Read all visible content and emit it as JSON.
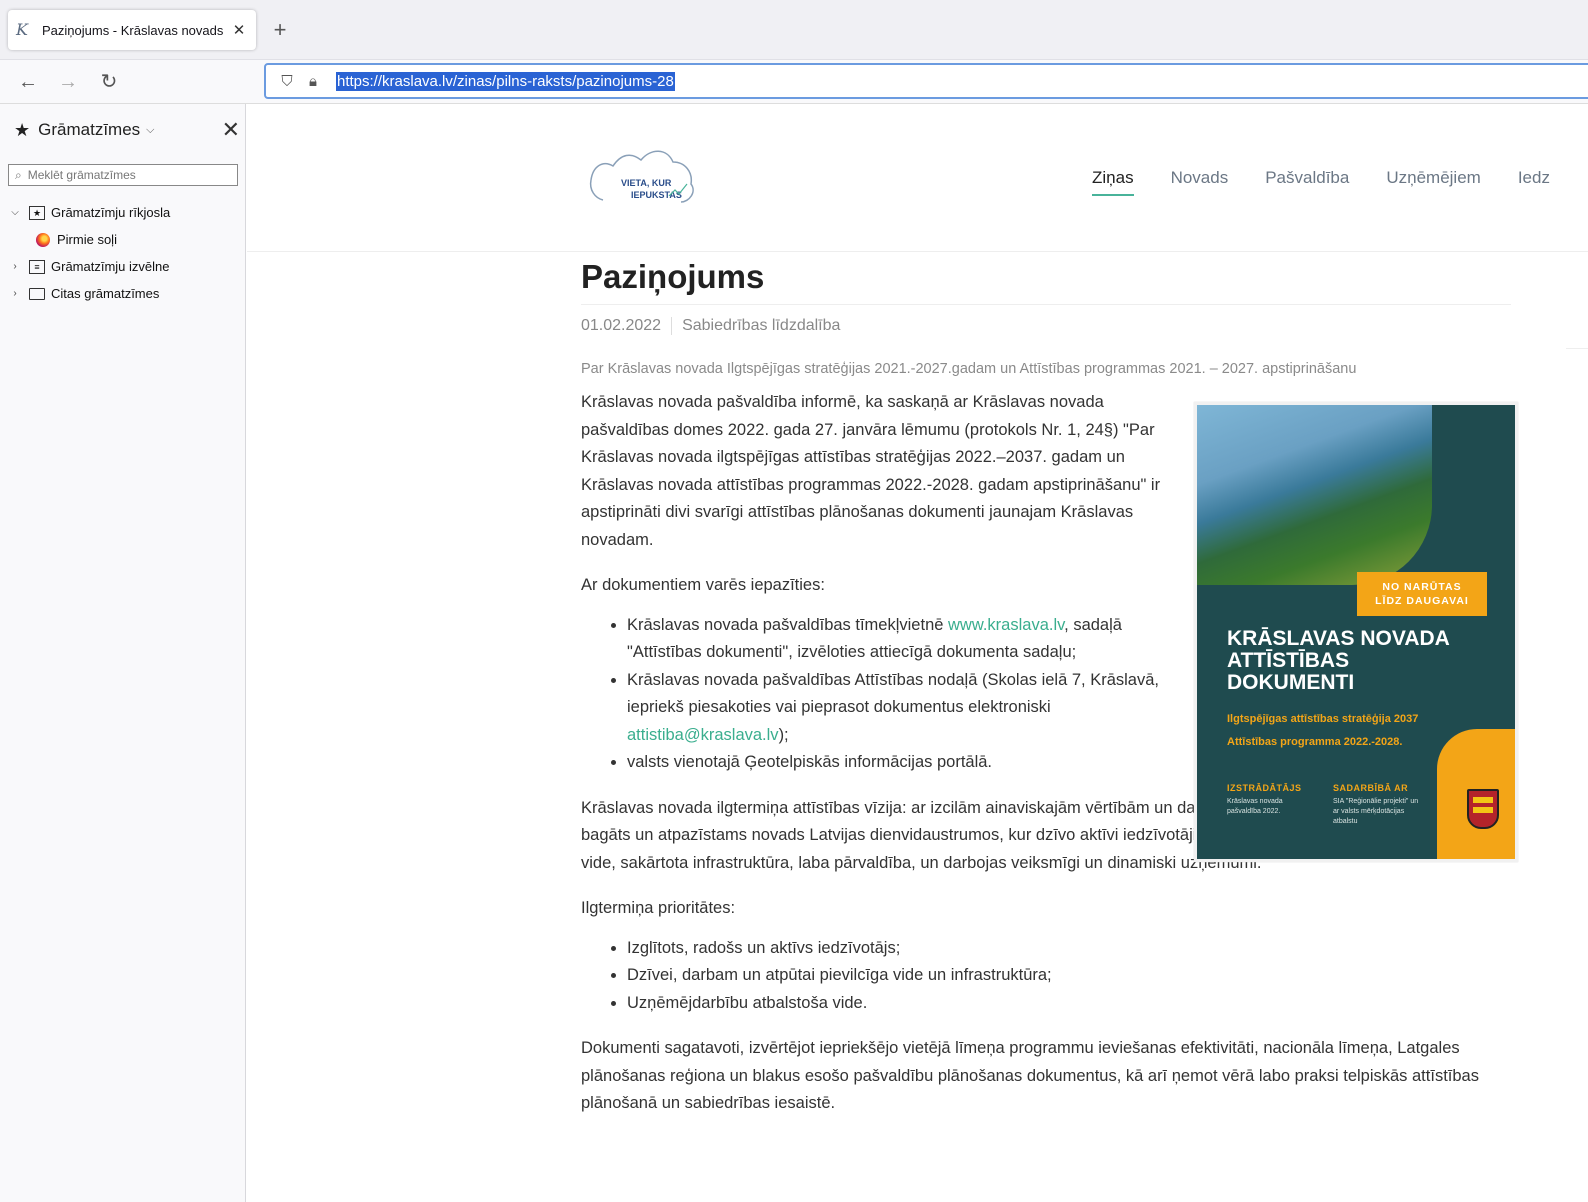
{
  "browser": {
    "tab_title": "Paziņojums - Krāslavas novads",
    "tab_favicon": "K",
    "url": "https://kraslava.lv/zinas/pilns-raksts/pazinojums-28"
  },
  "sidebar": {
    "title": "Grāmatzīmes",
    "search_placeholder": "Meklēt grāmatzīmes",
    "items": [
      {
        "label": "Grāmatzīmju rīkjosla",
        "expanded": true
      },
      {
        "label": "Pirmie soļi"
      },
      {
        "label": "Grāmatzīmju izvēlne",
        "expanded": false
      },
      {
        "label": "Citas grāmatzīmes",
        "expanded": false
      }
    ]
  },
  "site": {
    "logo_text_1": "VIETA, KUR",
    "logo_text_2": "IEPUKSTAS",
    "nav": [
      "Ziņas",
      "Novads",
      "Pašvaldība",
      "Uzņēmējiem",
      "Iedz"
    ]
  },
  "article": {
    "title": "Paziņojums",
    "date": "01.02.2022",
    "category": "Sabiedrības līdzdalība",
    "lead": "Par Krāslavas novada Ilgtspējīgas stratēģijas 2021.-2027.gadam un Attīstības programmas 2021. – 2027. apstiprināšanu",
    "p1": "Krāslavas novada pašvaldība informē, ka saskaņā ar Krāslavas novada pašvaldības domes 2022. gada 27. janvāra lēmumu (protokols Nr. 1, 24§) \"Par Krāslavas novada ilgtspējīgas attīstības stratēģijas 2022.–2037. gadam un Krāslavas novada attīstības programmas 2022.-2028. gadam apstiprināšanu\" ir apstiprināti divi svarīgi attīstības plānošanas dokumenti jaunajam Krāslavas novadam.",
    "p2": "Ar dokumentiem varēs iepazīties:",
    "li1_a": "Krāslavas novada pašvaldības tīmekļvietnē ",
    "li1_link": "www.kraslava.lv",
    "li1_b": ", sadaļā \"Attīstības dokumenti\", izvēloties attiecīgā dokumenta sadaļu;",
    "li2_a": "Krāslavas novada pašvaldības Attīstības nodaļā (Skolas ielā 7, Krāslavā, iepriekš piesakoties vai pieprasot dokumentus elektroniski ",
    "li2_link": "attistiba@kraslava.lv",
    "li2_b": ");",
    "li3": "valsts vienotajā Ģeotelpiskās informācijas portālā.",
    "p3": "Krāslavas novada ilgtermiņa attīstības vīzija: ar izcilām ainaviskajām vērtībām un daudzveidīgu kultūrvēsturisko mantojumu bagāts un atpazīstams novads Latvijas dienvidaustrumos, kur dzīvo aktīvi iedzīvotāji, ir visiem pieejama un pievilcīga dzīves vide, sakārtota infrastruktūra, laba pārvaldība, un darbojas veiksmīgi un dinamiski uzņēmumi.",
    "p4": "Ilgtermiņa prioritātes:",
    "prio1": "Izglītots, radošs un aktīvs iedzīvotājs;",
    "prio2": "Dzīvei, darbam un atpūtai pievilcīga vide un infrastruktūra;",
    "prio3": "Uzņēmējdarbību atbalstoša vide.",
    "p5": "Dokumenti sagatavoti, izvērtējot iepriekšējo vietējā līmeņa programmu ieviešanas efektivitāti, nacionāla līmeņa, Latgales plānošanas reģiona un blakus esošo pašvaldību plānošanas dokumentus, kā arī ņemot vērā labo praksi telpiskās attīstības plānošanā un sabiedrības iesaistē."
  },
  "poster": {
    "tag_line1": "NO NARŪTAS",
    "tag_line2": "LĪDZ DAUGAVAI",
    "title_line1": "KRĀSLAVAS NOVADA",
    "title_line2": "ATTĪSTĪBAS",
    "title_line3": "DOKUMENTI",
    "sub1": "Ilgtspējīgas attīstības stratēģija 2037",
    "sub2": "Attīstības programma 2022.-2028.",
    "col1_head": "IZSTRĀDĀTĀJS",
    "col1_body": "Krāslavas novada pašvaldība 2022.",
    "col2_head": "SADARBĪBĀ AR",
    "col2_body": "SIA \"Reģionālie projekti\" un ar valsts mērķdotācijas atbalstu"
  },
  "colors": {
    "accent": "#3aae8e",
    "poster_bg": "#1f4b4f",
    "poster_orange": "#f3a517",
    "url_highlight": "#2a63d4"
  }
}
